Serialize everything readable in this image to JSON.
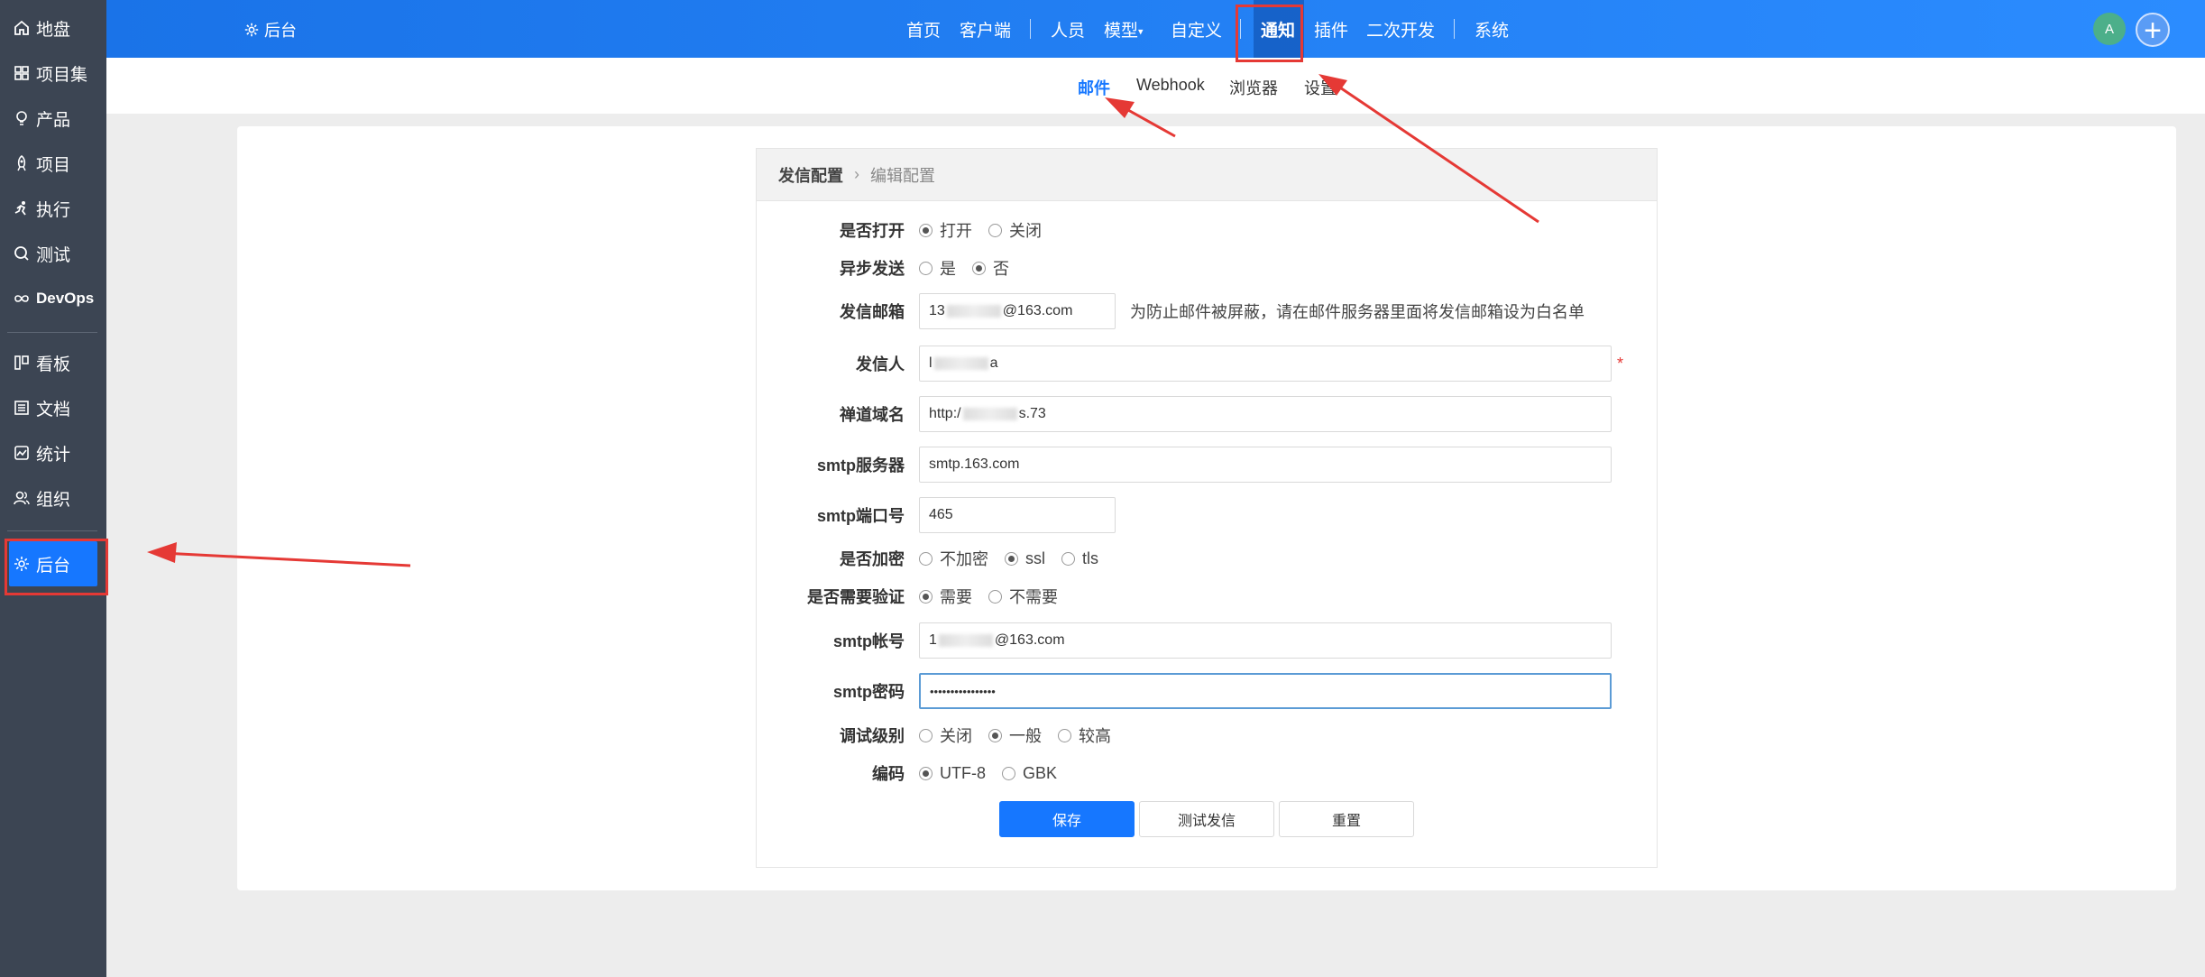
{
  "sidebar": {
    "items": [
      {
        "label": "地盘",
        "icon": "home-icon"
      },
      {
        "label": "项目集",
        "icon": "grid-icon"
      },
      {
        "label": "产品",
        "icon": "lightbulb-icon"
      },
      {
        "label": "项目",
        "icon": "rocket-icon"
      },
      {
        "label": "执行",
        "icon": "running-icon"
      },
      {
        "label": "测试",
        "icon": "search-icon"
      },
      {
        "label": "DevOps",
        "icon": "infinity-icon"
      },
      {
        "label": "看板",
        "icon": "kanban-icon"
      },
      {
        "label": "文档",
        "icon": "document-icon"
      },
      {
        "label": "统计",
        "icon": "chart-icon"
      },
      {
        "label": "组织",
        "icon": "users-icon"
      },
      {
        "label": "后台",
        "icon": "gear-icon"
      }
    ],
    "active": "后台"
  },
  "topbar": {
    "admin_label": "后台",
    "nav": [
      "首页",
      "客户端",
      "人员",
      "模型",
      "自定义",
      "通知",
      "插件",
      "二次开发",
      "系统"
    ],
    "active": "通知",
    "avatar_letter": "A",
    "plus_label": "+"
  },
  "subnav": {
    "items": [
      "邮件",
      "Webhook",
      "浏览器",
      "设置"
    ],
    "active": "邮件"
  },
  "breadcrumb": {
    "main": "发信配置",
    "sep": "›",
    "sub": "编辑配置"
  },
  "form": {
    "enabled": {
      "label": "是否打开",
      "options": [
        "打开",
        "关闭"
      ],
      "selected": "打开"
    },
    "async": {
      "label": "异步发送",
      "options": [
        "是",
        "否"
      ],
      "selected": "否"
    },
    "from_email": {
      "label": "发信邮箱",
      "value_prefix": "13",
      "value_suffix": "@163.com",
      "hint": "为防止邮件被屏蔽，请在邮件服务器里面将发信邮箱设为白名单"
    },
    "sender": {
      "label": "发信人",
      "value_prefix": "l",
      "value_suffix": "a",
      "required": "*"
    },
    "domain": {
      "label": "禅道域名",
      "value_prefix": "http:/",
      "value_suffix": "s.73"
    },
    "smtp_host": {
      "label": "smtp服务器",
      "value": "smtp.163.com"
    },
    "smtp_port": {
      "label": "smtp端口号",
      "value": "465"
    },
    "secure": {
      "label": "是否加密",
      "options": [
        "不加密",
        "ssl",
        "tls"
      ],
      "selected": "ssl"
    },
    "auth": {
      "label": "是否需要验证",
      "options": [
        "需要",
        "不需要"
      ],
      "selected": "需要"
    },
    "smtp_user": {
      "label": "smtp帐号",
      "value_prefix": "1",
      "value_suffix": "@163.com"
    },
    "smtp_pass": {
      "label": "smtp密码",
      "value": "••••••••••••••••"
    },
    "debug": {
      "label": "调试级别",
      "options": [
        "关闭",
        "一般",
        "较高"
      ],
      "selected": "一般"
    },
    "charset": {
      "label": "编码",
      "options": [
        "UTF-8",
        "GBK"
      ],
      "selected": "UTF-8"
    }
  },
  "buttons": {
    "save": "保存",
    "test": "测试发信",
    "reset": "重置"
  },
  "colors": {
    "accent": "#1677ff",
    "sidebar_bg": "#3c4553",
    "annotation": "#e53935"
  }
}
